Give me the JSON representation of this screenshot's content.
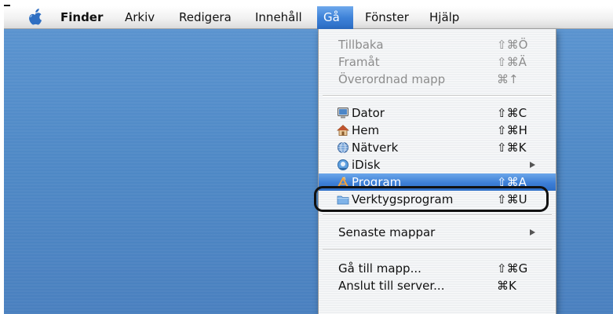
{
  "menubar": {
    "items": [
      {
        "label": "Finder"
      },
      {
        "label": "Arkiv"
      },
      {
        "label": "Redigera"
      },
      {
        "label": "Innehåll"
      },
      {
        "label": "Gå"
      },
      {
        "label": "Fönster"
      },
      {
        "label": "Hjälp"
      }
    ],
    "active_menu": "Gå",
    "apple_icon": "apple-logo-icon"
  },
  "menu": {
    "items": [
      {
        "label": "Tillbaka",
        "shortcut": "⇧⌘Ö",
        "enabled": false
      },
      {
        "label": "Framåt",
        "shortcut": "⇧⌘Ä",
        "enabled": false
      },
      {
        "label": "Överordnad mapp",
        "shortcut": "⌘↑",
        "enabled": false
      },
      {
        "label": "Dator",
        "shortcut": "⇧⌘C",
        "icon": "computer-icon"
      },
      {
        "label": "Hem",
        "shortcut": "⇧⌘H",
        "icon": "home-icon"
      },
      {
        "label": "Nätverk",
        "shortcut": "⇧⌘K",
        "icon": "network-icon"
      },
      {
        "label": "iDisk",
        "submenu": true,
        "icon": "idisk-icon"
      },
      {
        "label": "Program",
        "shortcut": "⇧⌘A",
        "icon": "applications-icon",
        "selected": true
      },
      {
        "label": "Verktygsprogram",
        "shortcut": "⇧⌘U",
        "icon": "utilities-folder-icon"
      },
      {
        "label": "Senaste mappar",
        "submenu": true
      },
      {
        "label": "Gå till mapp...",
        "shortcut": "⇧⌘G"
      },
      {
        "label": "Anslut till server...",
        "shortcut": "⌘K"
      }
    ]
  },
  "colors": {
    "desktop": "#4f89c6",
    "selection": "#3d7fd6",
    "disabled_text": "#8d8d8d"
  }
}
